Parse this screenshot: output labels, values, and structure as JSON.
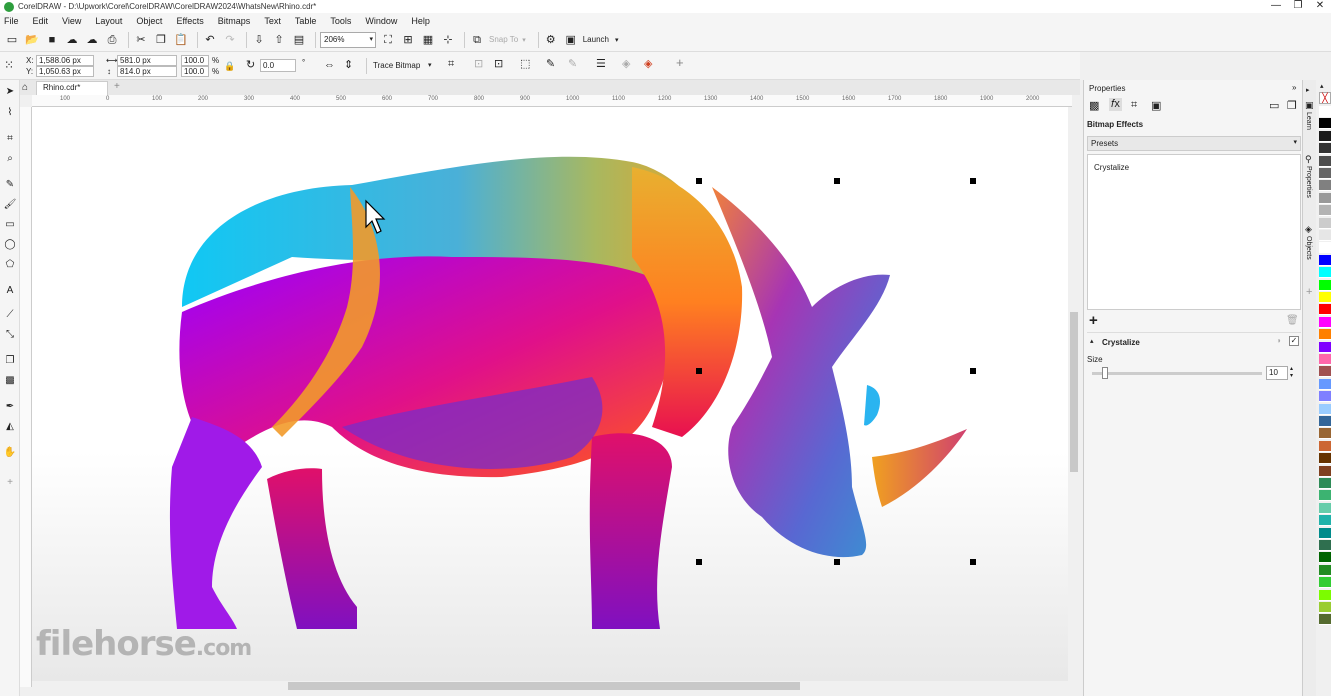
{
  "window": {
    "title": "CorelDRAW - D:\\Upwork\\Corel\\CorelDRAW\\CorelDRAW2024\\WhatsNew\\Rhino.cdr*",
    "minimize": "—",
    "maximize": "❐",
    "close": "✕"
  },
  "menu": [
    "File",
    "Edit",
    "View",
    "Layout",
    "Object",
    "Effects",
    "Bitmaps",
    "Text",
    "Table",
    "Tools",
    "Window",
    "Help"
  ],
  "toolbar": {
    "zoom_value": "206%",
    "snap_to": "Snap To",
    "launch": "Launch"
  },
  "property_bar": {
    "x_label": "X:",
    "x_value": "1,588.06 px",
    "y_label": "Y:",
    "y_value": "1,050.63 px",
    "width_value": "581.0 px",
    "height_value": "814.0 px",
    "scale_x": "100.0",
    "scale_y": "100.0",
    "percent": "%",
    "rotation_value": "0.0",
    "degree": "°",
    "trace_bitmap": "Trace Bitmap"
  },
  "document": {
    "tab_label": "Rhino.cdr*",
    "ruler_ticks": [
      "100",
      "0",
      "100",
      "200",
      "300",
      "400",
      "500",
      "600",
      "700",
      "800",
      "900",
      "1000",
      "1100",
      "1200",
      "1300",
      "1400",
      "1500",
      "1600",
      "1700",
      "1800",
      "1900",
      "2000"
    ]
  },
  "properties_panel": {
    "title": "Properties",
    "section": "Bitmap Effects",
    "presets_label": "Presets",
    "effect_list_item": "Crystalize",
    "add_symbol": "+",
    "effect_name": "Crystalize",
    "size_label": "Size",
    "size_value": "10"
  },
  "side_tabs": [
    "Learn",
    "Properties",
    "Objects"
  ],
  "watermark": {
    "brand": "filehorse",
    "tld": ".com"
  },
  "palette_colors": [
    "#ffffff",
    "#000000",
    "#1a1a1a",
    "#333333",
    "#4d4d4d",
    "#666666",
    "#808080",
    "#999999",
    "#b3b3b3",
    "#cccccc",
    "#e6e6e6",
    "#ffffff",
    "#0000ff",
    "#00ffff",
    "#00ff00",
    "#ffff00",
    "#ff0000",
    "#ff00ff",
    "#ff8000",
    "#8000ff",
    "#ff66aa",
    "#a05050",
    "#6699ff",
    "#7f7fff",
    "#99ccff",
    "#336699",
    "#996633",
    "#cc6633",
    "#663300",
    "#804020",
    "#2e8b57",
    "#3cb371",
    "#66cdaa",
    "#20b2aa",
    "#008b8b",
    "#2f6f4f",
    "#006400",
    "#228b22",
    "#32cd32",
    "#7cfc00",
    "#9acd32",
    "#556b2f"
  ]
}
